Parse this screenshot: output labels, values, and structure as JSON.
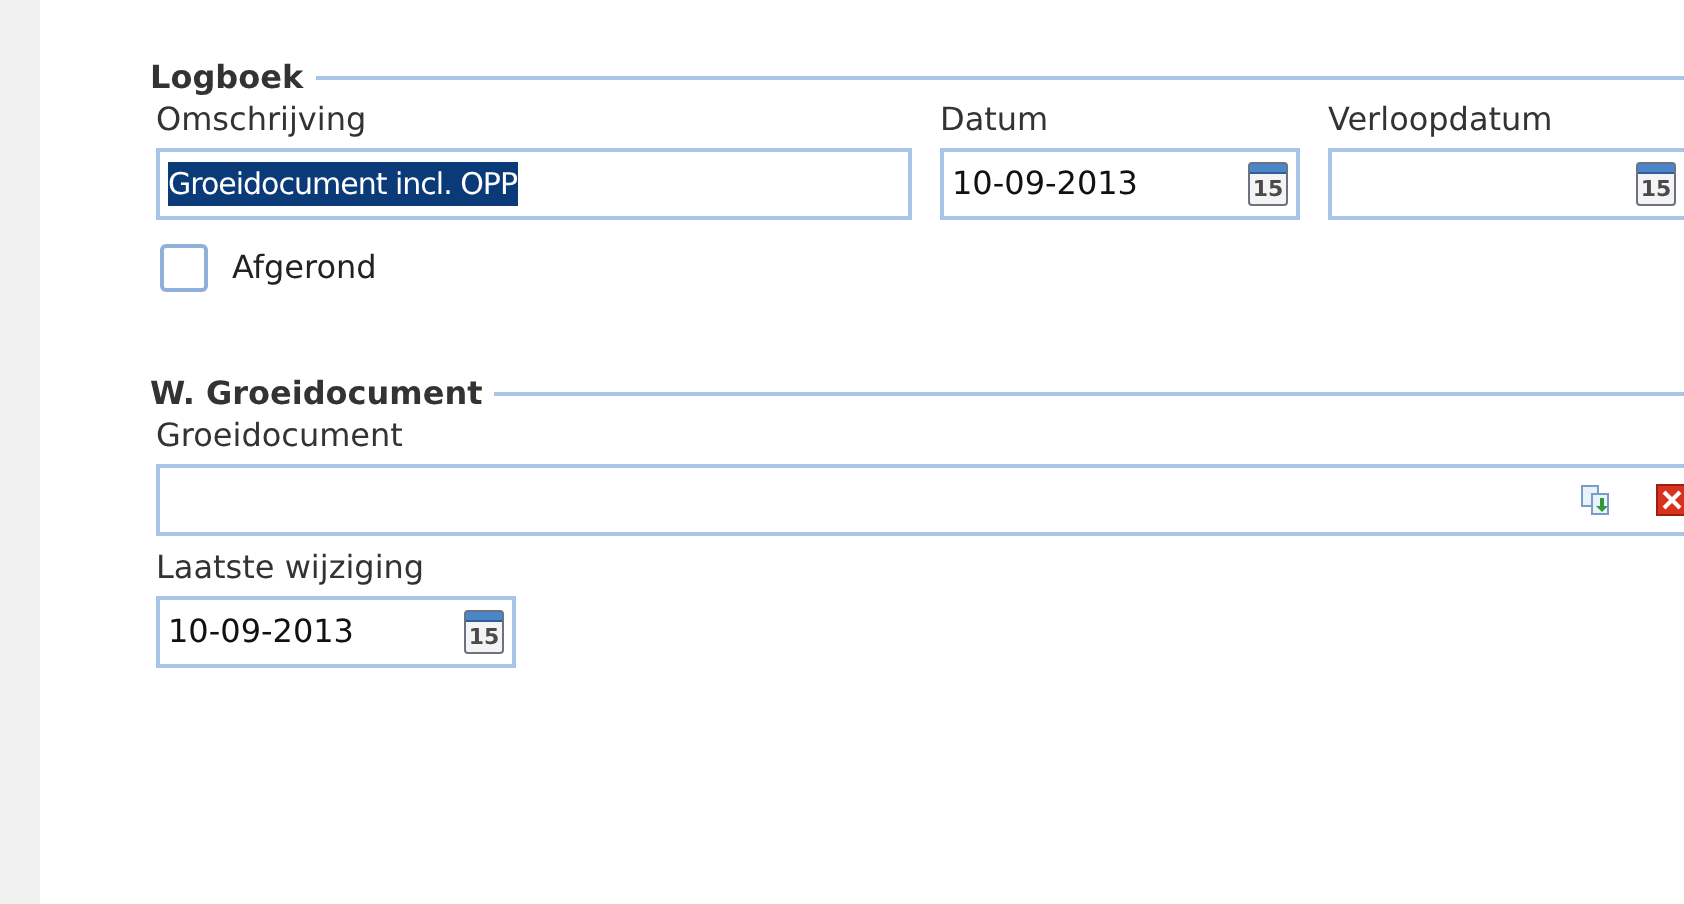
{
  "sections": [
    {
      "title": "Logboek",
      "fields": [
        {
          "kind": "text",
          "label": "Omschrijving",
          "value": "Groeidocument incl. OPP",
          "selected": true
        },
        {
          "kind": "date",
          "label": "Datum",
          "value": "10-09-2013",
          "icon_label": "15"
        },
        {
          "kind": "date",
          "label": "Verloopdatum",
          "icon_label": "15"
        }
      ],
      "checkbox": {
        "label": "Afgerond",
        "checked": false
      }
    },
    {
      "title": "W. Groeidocument",
      "fields": [
        {
          "kind": "file",
          "label": "Groeidocument"
        },
        {
          "kind": "date",
          "label": "Laatste wijziging",
          "value": "10-09-2013",
          "icon_label": "15"
        }
      ]
    }
  ]
}
